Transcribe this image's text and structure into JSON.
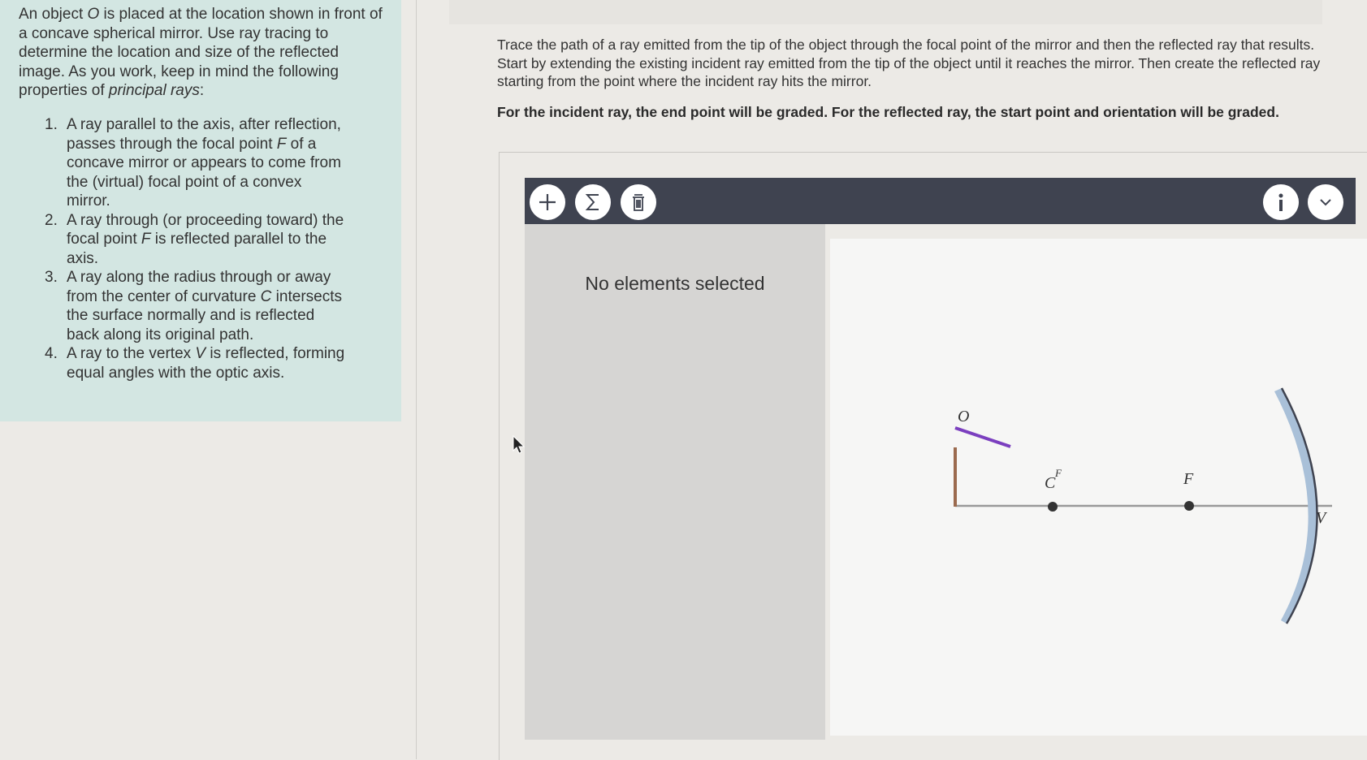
{
  "left_panel": {
    "intro_parts": [
      "An object ",
      "O",
      " is placed at the location shown in front of a concave spherical mirror. Use ray tracing to determine the location and size of the reflected image. As you work, keep in mind the following properties of ",
      "principal rays",
      ":"
    ],
    "rays": [
      {
        "num": "1.",
        "parts": [
          "A ray parallel to the axis, after reflection, passes through the focal point ",
          "F",
          " of a concave mirror or appears to come from the (virtual) focal point of a convex mirror."
        ]
      },
      {
        "num": "2.",
        "parts": [
          "A ray through (or proceeding toward) the focal point ",
          "F",
          " is reflected parallel to the axis."
        ]
      },
      {
        "num": "3.",
        "parts": [
          "A ray along the radius through or away from the center of curvature ",
          "C",
          " intersects the surface normally and is reflected back along its original path."
        ]
      },
      {
        "num": "4.",
        "parts": [
          "A ray to the vertex ",
          "V",
          " is reflected, forming equal angles with the optic axis."
        ]
      }
    ]
  },
  "instructions": "Trace the path of a ray emitted from the tip of the object through the focal point of the mirror and then the reflected ray that results. Start by extending the existing incident ray emitted from the tip of the object until it reaches the mirror. Then create the reflected ray starting from the point where the incident ray hits the mirror.",
  "grading_note": "For the incident ray, the end point will be graded. For the reflected ray, the start point and orientation will be graded.",
  "toolbar": {
    "add_icon": "plus-icon",
    "sum_icon": "sigma-icon",
    "delete_icon": "trash-icon",
    "info_icon": "info-icon",
    "expand_icon": "chevron-down-icon",
    "color": "#3f4350"
  },
  "side_panel": {
    "message": "No elements selected"
  },
  "diagram": {
    "labels": {
      "object": "O",
      "center": "C",
      "focal": "F",
      "focal_small": "F",
      "vertex": "V"
    },
    "colors": {
      "object": "#9b6a4e",
      "ray": "#7b3fbf",
      "mirror": "#a9c0d8",
      "axis": "#999999"
    }
  }
}
